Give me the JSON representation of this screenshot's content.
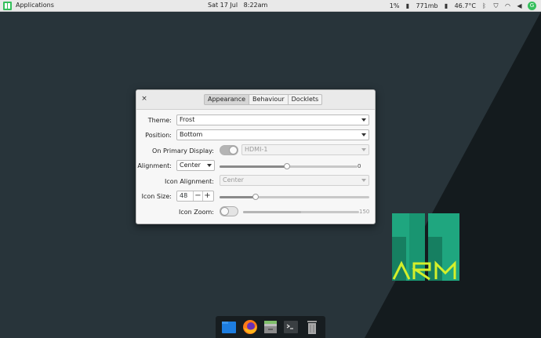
{
  "top_panel": {
    "apps_label": "Applications",
    "clock": "Sat 17 Jul   8:22am",
    "cpu": "1%",
    "memory": "771mb",
    "temperature": "46.7°C"
  },
  "dialog": {
    "close_glyph": "×",
    "tabs": [
      {
        "label": "Appearance",
        "active": true
      },
      {
        "label": "Behaviour",
        "active": false
      },
      {
        "label": "Docklets",
        "active": false
      }
    ],
    "theme": {
      "label": "Theme:",
      "value": "Frost"
    },
    "position": {
      "label": "Position:",
      "value": "Bottom"
    },
    "primary_display": {
      "label": "On Primary Display:",
      "enabled": true,
      "value": "HDMI-1"
    },
    "alignment": {
      "label": "Alignment:",
      "value": "Center",
      "offset": 0,
      "offset_label": "0",
      "slider_fraction": 0.49
    },
    "icon_alignment": {
      "label": "Icon Alignment:",
      "value": "Center"
    },
    "icon_size": {
      "label": "Icon Size:",
      "value": "48",
      "minus": "−",
      "plus": "+",
      "slider_fraction": 0.24
    },
    "icon_zoom": {
      "label": "Icon Zoom:",
      "enabled": false,
      "value_label": "150",
      "slider_fraction": 0.5
    }
  },
  "logo": {
    "text": "ARM",
    "colors": {
      "green": "#1fa67f",
      "yellow": "#d4ef2a"
    }
  },
  "dock": {
    "items": [
      {
        "name": "files-folder-icon"
      },
      {
        "name": "firefox-icon"
      },
      {
        "name": "file-manager-icon"
      },
      {
        "name": "terminal-icon"
      },
      {
        "name": "trash-icon"
      }
    ]
  },
  "colors": {
    "desktop": "#28343a",
    "accent": "#35bf5c"
  }
}
